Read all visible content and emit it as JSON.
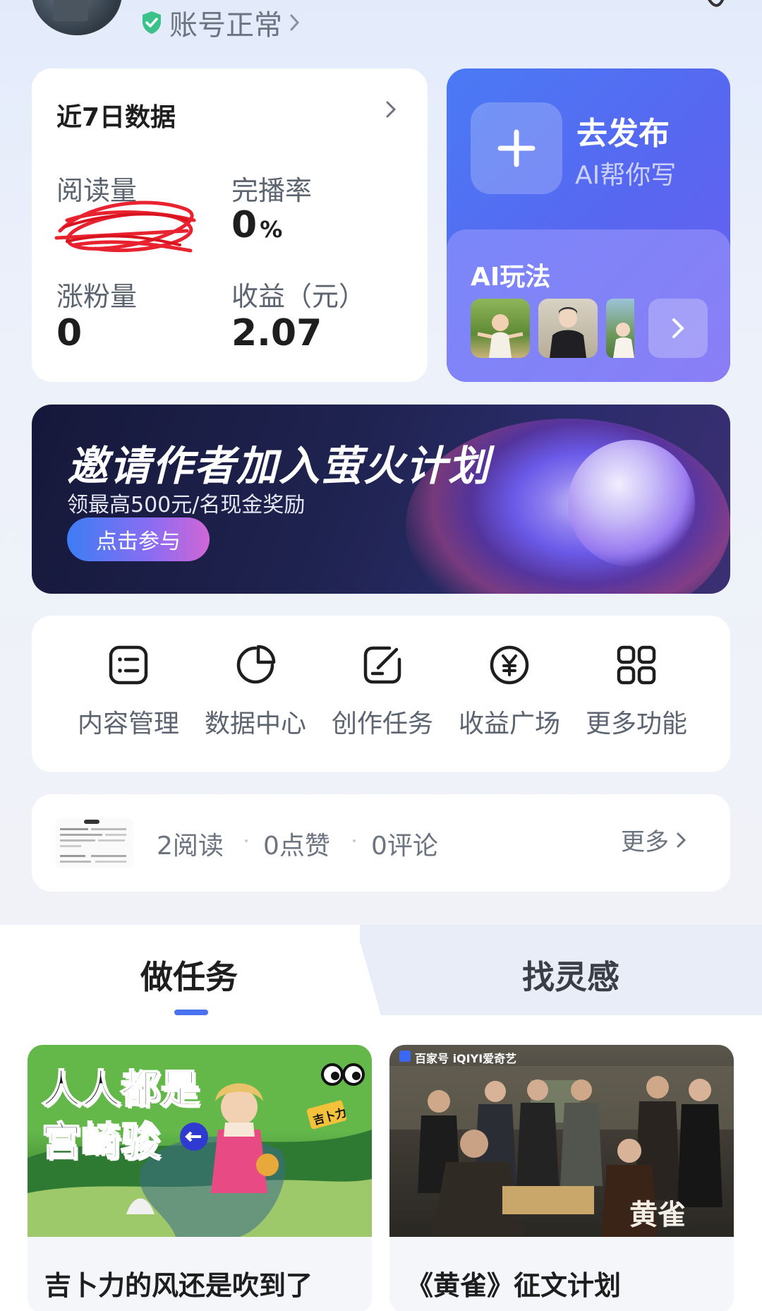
{
  "header": {
    "account_status": "账号正常",
    "status_color": "#3bc28a"
  },
  "data_card": {
    "title": "近7日数据",
    "metrics": [
      {
        "label": "阅读量",
        "value": ""
      },
      {
        "label": "完播率",
        "value": "0",
        "unit": "%"
      },
      {
        "label": "涨粉量",
        "value": "0"
      },
      {
        "label": "收益（元）",
        "value": "2.07"
      }
    ]
  },
  "publish": {
    "title": "去发布",
    "subtitle": "AI帮你写",
    "ai_title": "AI玩法"
  },
  "banner": {
    "title": "邀请作者加入萤火计划",
    "subtitle": "领最高500元/名现金奖励",
    "button": "点击参与"
  },
  "tools": [
    {
      "label": "内容管理",
      "icon": "list-icon"
    },
    {
      "label": "数据中心",
      "icon": "pie-chart-icon"
    },
    {
      "label": "创作任务",
      "icon": "edit-icon"
    },
    {
      "label": "收益广场",
      "icon": "yen-icon"
    },
    {
      "label": "更多功能",
      "icon": "grid-icon"
    }
  ],
  "recent": {
    "reads": "2阅读",
    "likes": "0点赞",
    "comments": "0评论",
    "more": "更多"
  },
  "tabs": [
    {
      "label": "做任务",
      "active": true
    },
    {
      "label": "找灵感",
      "active": false
    }
  ],
  "tasks": [
    {
      "title": "吉卜力的风还是吹到了",
      "img_text_1": "人人都是",
      "img_text_2": "宫崎骏",
      "badge": "吉卜力"
    },
    {
      "title": "《黄雀》征文计划",
      "brand": "百家号 iQIYI爱奇艺",
      "movie": "黄雀"
    }
  ],
  "colors": {
    "accent": "#4a72f0",
    "publish_bg": "#5866f0",
    "banner_bg": "#1f2350"
  }
}
